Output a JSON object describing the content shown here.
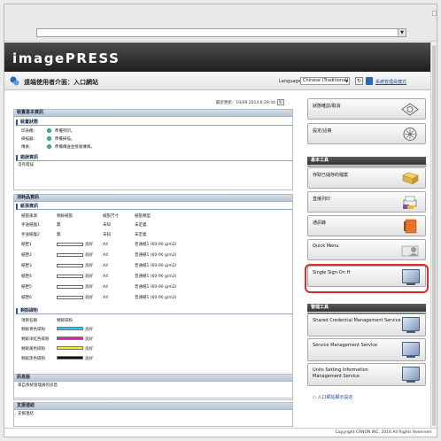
{
  "header": {
    "brand": "imagePRESS",
    "page_title": "遠端使用者介面：入口網站",
    "language_label": "Language:",
    "language_value": "Chinese (Traditional)",
    "sysadmin_link": "系統管理員模式",
    "updated": "最近更新：19/09 2014 6:29:44"
  },
  "main": {
    "basic_info_title": "裝置基本資訊",
    "device_status_title": "裝置狀態",
    "status_rows": [
      {
        "label": "印表機：",
        "value": "準備列印。"
      },
      {
        "label": "掃描器：",
        "value": "準備掃描。"
      },
      {
        "label": "傳真：",
        "value": "準備傳送並接收傳真。"
      }
    ],
    "error_title": "錯誤資訊",
    "error_text": "沒有錯誤",
    "consumables_title": "消耗品資訊",
    "paper_title": "紙張資訊",
    "paper_headers": [
      "紙張來源",
      "剩餘紙張",
      "紙張尺寸",
      "紙張類型"
    ],
    "paper_rows": [
      {
        "src": "手送紙盤1",
        "remain": "無",
        "size": "未知",
        "type": "未定義"
      },
      {
        "src": "手送紙盤2",
        "remain": "無",
        "size": "未知",
        "type": "未定義"
      },
      {
        "src": "紙匣1",
        "remain": "良好",
        "size": "A4",
        "type": "普通紙1 (60-90 g/m2)"
      },
      {
        "src": "紙匣2",
        "remain": "良好",
        "size": "A4",
        "type": "普通紙1 (60-90 g/m2)"
      },
      {
        "src": "紙匣3",
        "remain": "良好",
        "size": "A4",
        "type": "普通紙1 (60-90 g/m2)"
      },
      {
        "src": "紙匣4",
        "remain": "良好",
        "size": "A4",
        "type": "普通紙1 (60-90 g/m2)"
      },
      {
        "src": "紙匣5",
        "remain": "良好",
        "size": "A4",
        "type": "普通紙1 (60-90 g/m2)"
      },
      {
        "src": "紙匣6",
        "remain": "良好",
        "size": "A4",
        "type": "普通紙1 (60-90 g/m2)"
      }
    ],
    "toner_title": "剩餘碳粉",
    "toner_headers": [
      "項目名稱",
      "剩餘碳粉"
    ],
    "toner_rows": [
      {
        "name": "剩餘青色碳粉",
        "level": "良好",
        "color": "#12d6e8"
      },
      {
        "name": "剩餘洋紅色碳粉",
        "level": "良好",
        "color": "#e61fb0"
      },
      {
        "name": "剩餘黃色碳粉",
        "level": "良好",
        "color": "#f0f01a"
      },
      {
        "name": "剩餘黑色碳粉",
        "level": "良好",
        "color": "#111111"
      }
    ],
    "messages_title": "訊息版",
    "messages_text": "來自系統管理員的訊息",
    "support_title": "支援連結",
    "support_text": "支援連結"
  },
  "sidebar": {
    "status_monitor": "狀態確認/取消",
    "settings": "設定/註冊",
    "basic_tools_title": "基本工具",
    "tools": [
      {
        "label": "存取已儲存的檔案"
      },
      {
        "label": "直接列印"
      },
      {
        "label": "通訊錄"
      },
      {
        "label": "Quick Menu"
      },
      {
        "label": "Single Sign-On H"
      }
    ],
    "mgmt_tools_title": "管理工具",
    "mgmt": [
      {
        "label": "Shared Credential Management Service"
      },
      {
        "label": "Service Management Service"
      },
      {
        "label": "Units Setting Information Management Service"
      }
    ],
    "portal_link": "入口網站顯示設定"
  },
  "footer": {
    "copyright": "Copyright CANON INC. 2016 All Rights Reserved"
  },
  "colors": {
    "accent": "#2d5b99",
    "highlight": "#d62d2d",
    "status_ok": "#34c48a"
  }
}
